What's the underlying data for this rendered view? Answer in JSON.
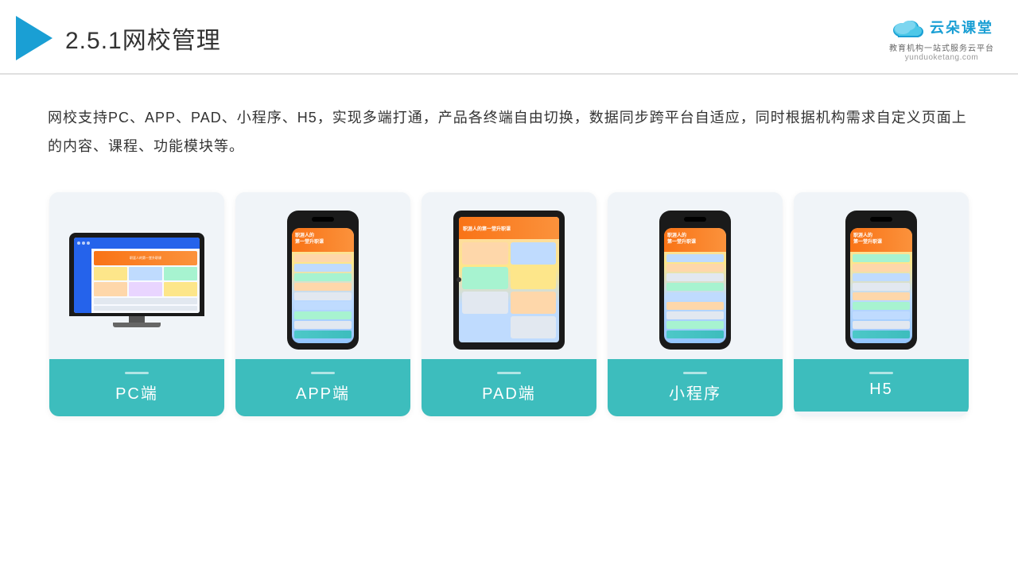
{
  "header": {
    "title_number": "2.5.1",
    "title_text": "网校管理"
  },
  "logo": {
    "main_text": "云朵课堂",
    "url": "yunduoketang.com",
    "tagline": "教育机构一站\n式服务云平台"
  },
  "description": {
    "text": "网校支持PC、APP、PAD、小程序、H5，实现多端打通，产品各终端自由切换，数据同步跨平台自适应，同时根据机构需求自定义页面上的内容、课程、功能模块等。"
  },
  "cards": [
    {
      "id": "pc",
      "label": "PC端"
    },
    {
      "id": "app",
      "label": "APP端"
    },
    {
      "id": "pad",
      "label": "PAD端"
    },
    {
      "id": "miniapp",
      "label": "小程序"
    },
    {
      "id": "h5",
      "label": "H5"
    }
  ]
}
